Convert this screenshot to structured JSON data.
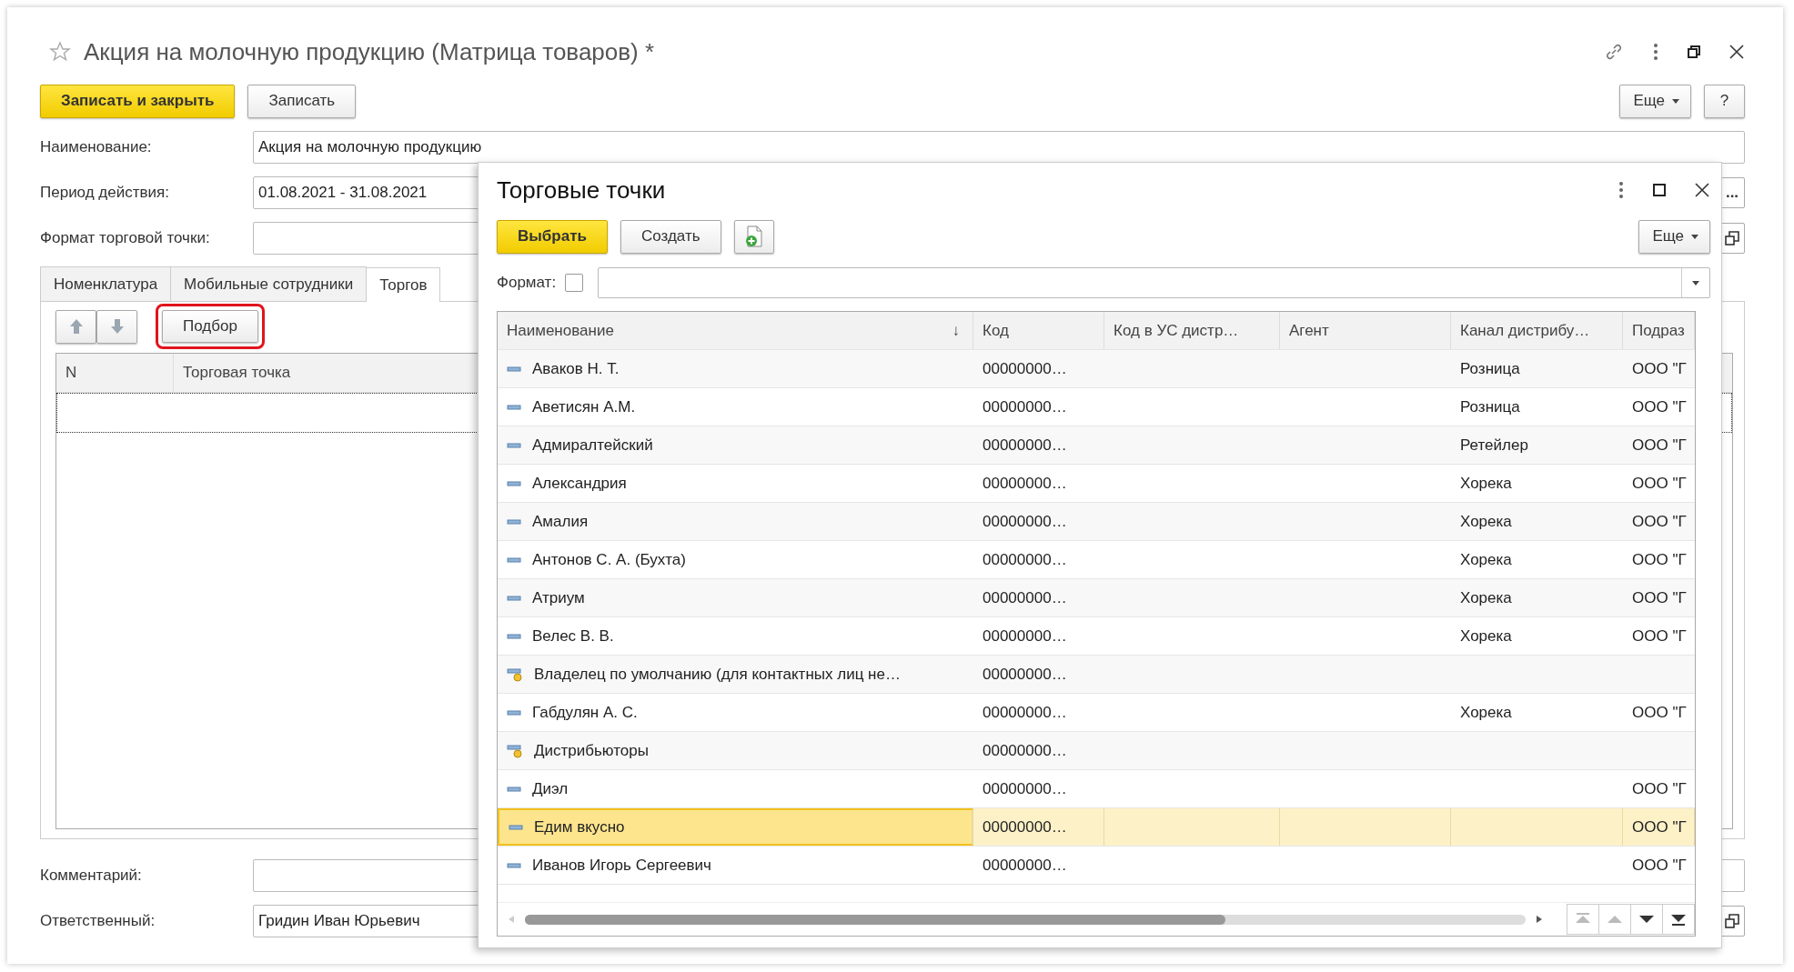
{
  "window": {
    "title": "Акция на молочную продукцию (Матрица товаров) *",
    "favorite": false
  },
  "toolbar": {
    "buttons": [
      {
        "label": "Записать и закрыть",
        "kind": "primary"
      },
      {
        "label": "Записать",
        "kind": "normal"
      }
    ],
    "more": "Еще",
    "help": "?"
  },
  "fields": [
    {
      "label": "Наименование:",
      "value": "Акция на молочную продукцию"
    },
    {
      "label": "Период действия:",
      "value": "01.08.2021 - 31.08.2021",
      "action": {
        "kind": "select",
        "text": "..."
      }
    },
    {
      "label": "Формат торговой точки:",
      "action": {
        "kind": "open"
      }
    }
  ],
  "tabs": [
    {
      "label": "Номенклатура",
      "selected": false
    },
    {
      "label": "Мобильные сотрудники",
      "selected": false
    },
    {
      "label": "Торгов",
      "selected": true
    }
  ],
  "tab_toolbar": {
    "pick_button": "Подбор",
    "highlighted": true
  },
  "tab_table": {
    "columns": [
      "N",
      "Торговая точка"
    ]
  },
  "footer_fields": [
    {
      "label": "Комментарий:"
    },
    {
      "label": "Ответственный:",
      "value": "Гридин Иван Юрьевич",
      "action": {
        "kind": "open"
      }
    }
  ],
  "dialog": {
    "title": "Торговые точки",
    "buttons": [
      {
        "label": "Выбрать",
        "kind": "primary"
      },
      {
        "label": "Создать",
        "kind": "normal"
      },
      {
        "kind": "add_document"
      }
    ],
    "more": "Еще",
    "filter": {
      "label": "Формат:",
      "checked": false
    },
    "table": {
      "columns": [
        {
          "title": "Наименование",
          "sort_mark": "↓"
        },
        {
          "title": "Код"
        },
        {
          "title": "Код в УС дистр…"
        },
        {
          "title": "Агент"
        },
        {
          "title": "Канал дистрибу…"
        },
        {
          "title": "Подраз"
        }
      ],
      "rows": [
        {
          "kind": "item",
          "selected": false,
          "name": "Аваков Н. Т.",
          "code": "00000000…",
          "channel": "Розница",
          "division": "ООО \"Г"
        },
        {
          "kind": "item",
          "selected": false,
          "name": "Аветисян А.М.",
          "code": "00000000…",
          "channel": "Розница",
          "division": "ООО \"Г"
        },
        {
          "kind": "item",
          "selected": false,
          "name": "Адмиралтейский",
          "code": "00000000…",
          "channel": "Ретейлер",
          "division": "ООО \"Г"
        },
        {
          "kind": "item",
          "selected": false,
          "name": "Александрия",
          "code": "00000000…",
          "channel": "Хорека",
          "division": "ООО \"Г"
        },
        {
          "kind": "item",
          "selected": false,
          "name": "Амалия",
          "code": "00000000…",
          "channel": "Хорека",
          "division": "ООО \"Г"
        },
        {
          "kind": "item",
          "selected": false,
          "name": "Антонов С. А. (Бухта)",
          "code": "00000000…",
          "channel": "Хорека",
          "division": "ООО \"Г"
        },
        {
          "kind": "item",
          "selected": false,
          "name": "Атриум",
          "code": "00000000…",
          "channel": "Хорека",
          "division": "ООО \"Г"
        },
        {
          "kind": "item",
          "selected": false,
          "name": "Велес В. В.",
          "code": "00000000…",
          "channel": "Хорека",
          "division": "ООО \"Г"
        },
        {
          "kind": "marked",
          "selected": false,
          "name": "Владелец по умолчанию (для контактных лиц не…",
          "code": "00000000…"
        },
        {
          "kind": "item",
          "selected": false,
          "name": "Габдулян А. С.",
          "code": "00000000…",
          "channel": "Хорека",
          "division": "ООО \"Г"
        },
        {
          "kind": "marked",
          "selected": false,
          "name": "Дистрибьюторы",
          "code": "00000000…"
        },
        {
          "kind": "item",
          "selected": false,
          "name": "Диэл",
          "code": "00000000…",
          "division": "ООО \"Г"
        },
        {
          "kind": "item",
          "selected": true,
          "name": "Едим вкусно",
          "code": "00000000…",
          "division": "ООО \"Г"
        },
        {
          "kind": "item",
          "selected": false,
          "name": "Иванов Игорь Сергеевич",
          "code": "00000000…",
          "division": "ООО \"Г"
        }
      ]
    }
  }
}
